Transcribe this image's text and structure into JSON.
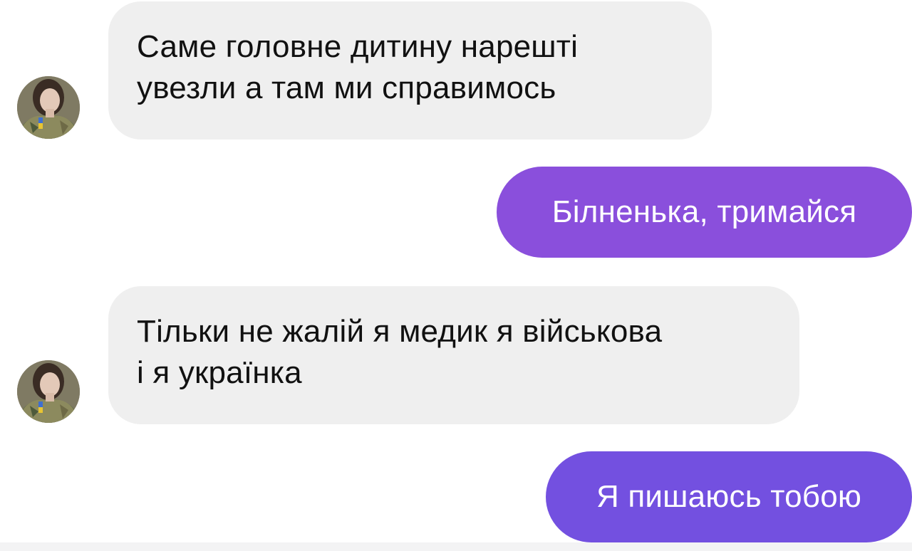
{
  "colors": {
    "incoming_bubble": "#efefef",
    "outgoing_bubble_1": "#8a4fdc",
    "outgoing_bubble_2": "#7350e0"
  },
  "messages": [
    {
      "direction": "incoming",
      "avatar": "user-avatar-icon",
      "lines": [
        "Саме головне дитину нарешті",
        "увезли а там ми справимось"
      ]
    },
    {
      "direction": "outgoing",
      "text": "Білненька, тримайся"
    },
    {
      "direction": "incoming",
      "avatar": "user-avatar-icon",
      "lines": [
        "Тільки не жалій я медик я військова",
        "і я українка"
      ]
    },
    {
      "direction": "outgoing",
      "text": "Я пишаюсь тобою"
    }
  ]
}
